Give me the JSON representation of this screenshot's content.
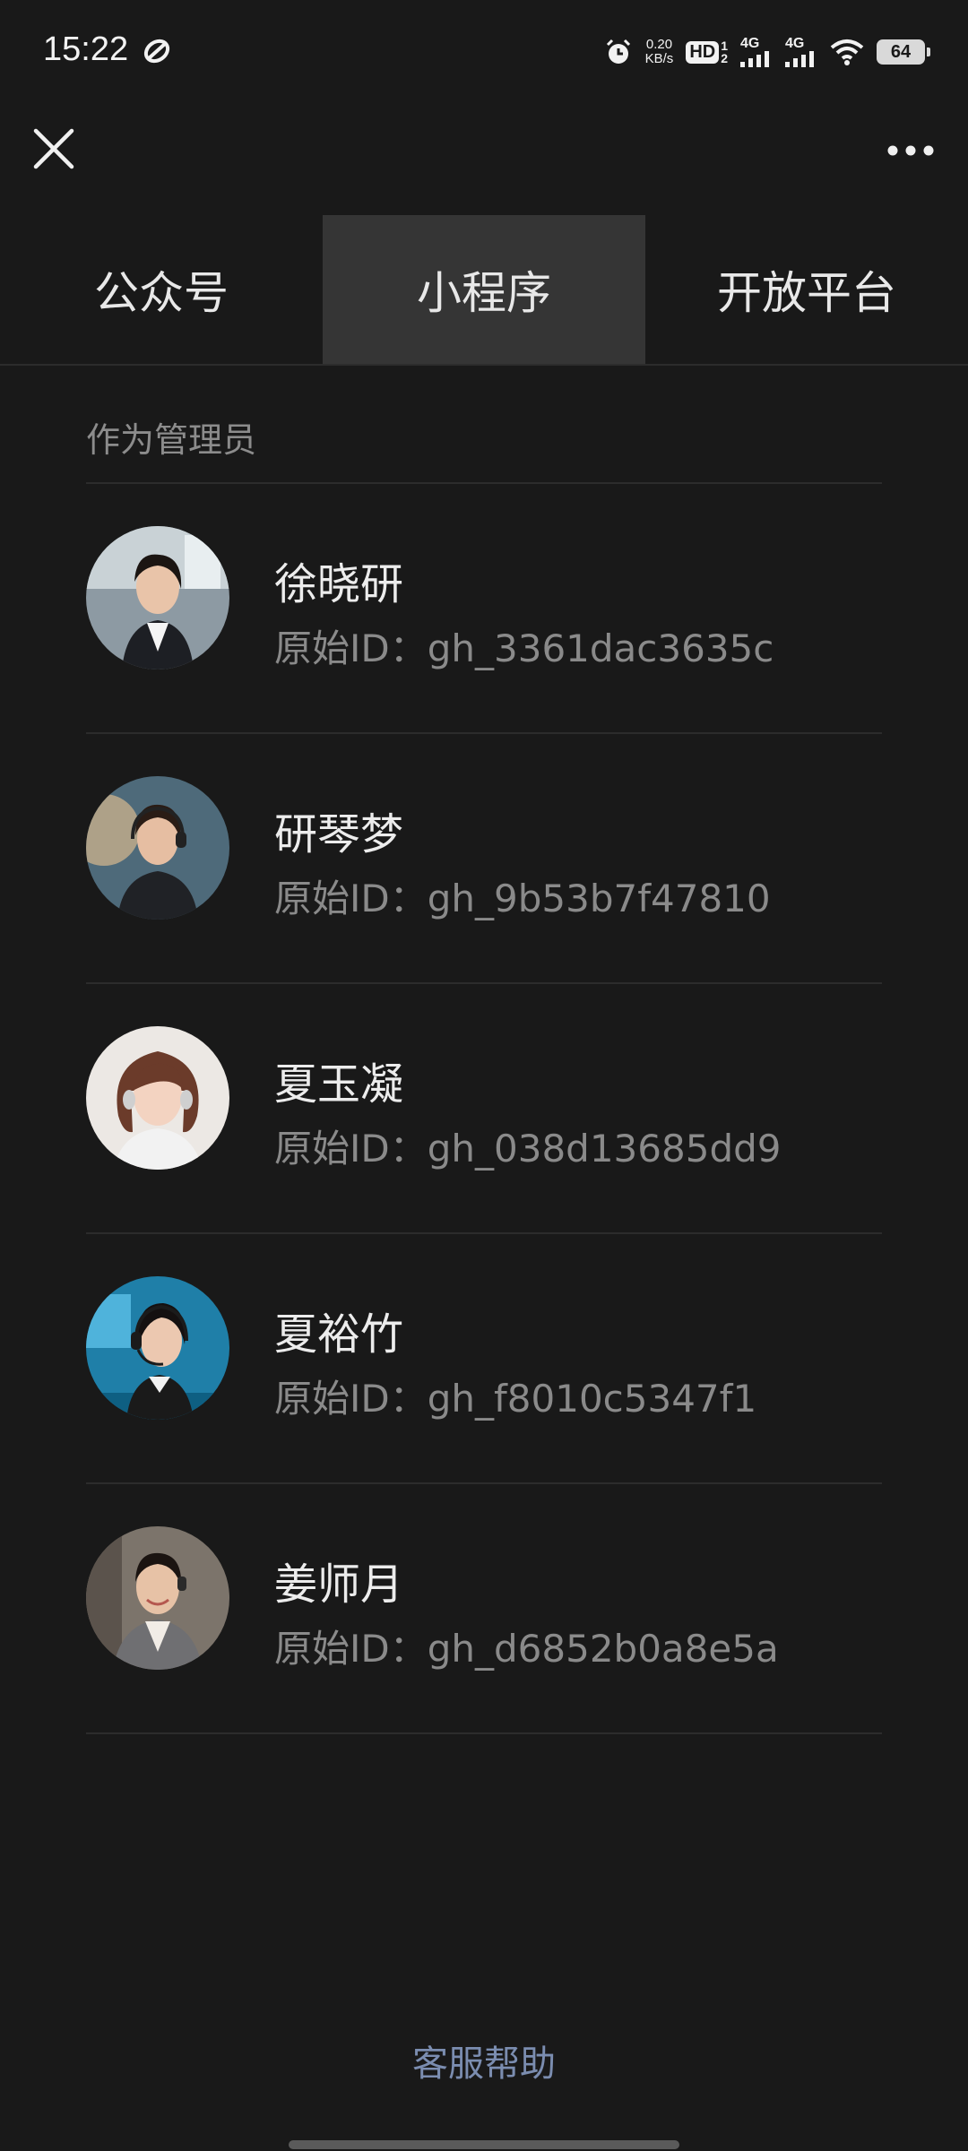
{
  "status_bar": {
    "time": "15:22",
    "net_speed_value": "0.20",
    "net_speed_unit": "KB/s",
    "hd_badge": "HD",
    "hd_sub_1": "1",
    "hd_sub_2": "2",
    "signal_1_label": "4G",
    "signal_2_label": "4G",
    "battery": "64",
    "icons": [
      "app-logo-icon",
      "alarm-icon",
      "signal-icon",
      "wifi-icon",
      "battery-icon"
    ]
  },
  "nav": {
    "close_icon": "close-icon",
    "more_icon": "more-icon"
  },
  "tabs": [
    {
      "label": "公众号",
      "active": false
    },
    {
      "label": "小程序",
      "active": true
    },
    {
      "label": "开放平台",
      "active": false
    }
  ],
  "section": {
    "title": "作为管理员"
  },
  "accounts": [
    {
      "name": "徐晓研",
      "id": "原始ID：gh_3361dac3635c"
    },
    {
      "name": "研琴梦",
      "id": "原始ID：gh_9b53b7f47810"
    },
    {
      "name": "夏玉凝",
      "id": "原始ID：gh_038d13685dd9"
    },
    {
      "name": "夏裕竹",
      "id": "原始ID：gh_f8010c5347f1"
    },
    {
      "name": "姜师月",
      "id": "原始ID：gh_d6852b0a8e5a"
    }
  ],
  "footer": {
    "help_label": "客服帮助"
  },
  "colors": {
    "background": "#191919",
    "active_tab": "#353535",
    "link": "#7b8db0"
  }
}
